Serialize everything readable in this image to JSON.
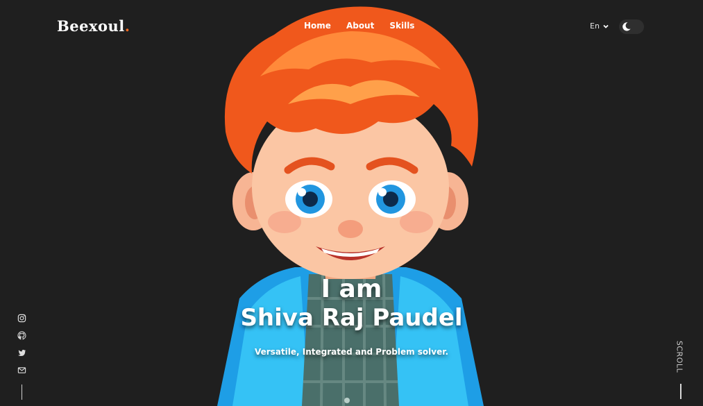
{
  "brand": {
    "name": "Beexoul",
    "dot": ".",
    "accent_color": "#f26a21"
  },
  "nav": [
    {
      "label": "Home"
    },
    {
      "label": "About"
    },
    {
      "label": "Skills"
    }
  ],
  "language": {
    "selected": "En"
  },
  "theme_toggle": {
    "icon": "moon-icon",
    "state": "dark"
  },
  "hero": {
    "image": "cartoon-boy-avatar",
    "line1": "I am",
    "line2": "Shiva Raj Paudel",
    "tagline": "Versatile, Integrated and Problem solver."
  },
  "social": [
    {
      "icon": "instagram-icon"
    },
    {
      "icon": "github-icon"
    },
    {
      "icon": "twitter-icon"
    },
    {
      "icon": "mail-icon"
    }
  ],
  "scroll": {
    "label": "SCROLL"
  },
  "colors": {
    "background": "#1f1f1f",
    "text": "#ffffff",
    "accent": "#f26a21"
  }
}
